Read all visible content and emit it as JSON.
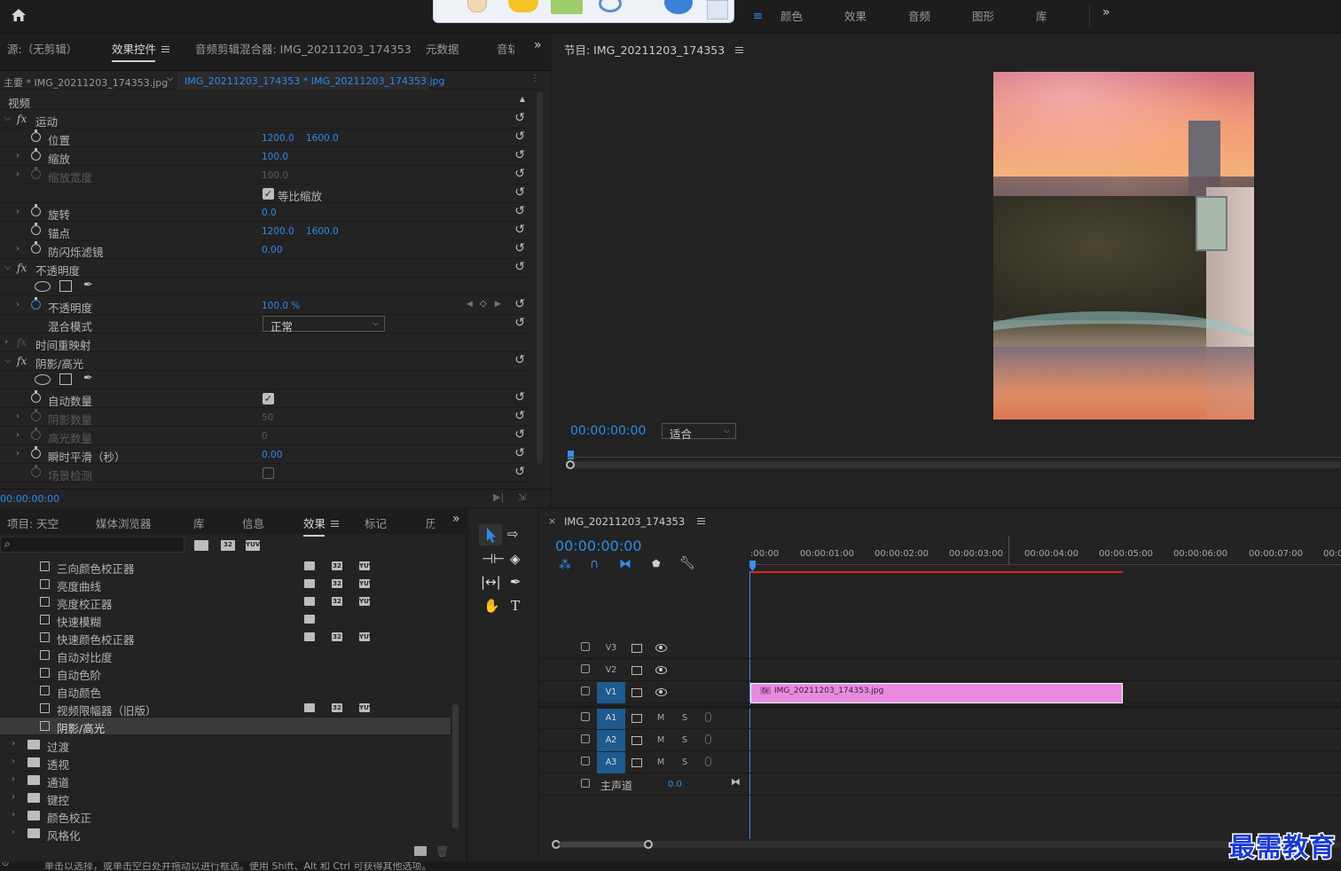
{
  "top": {
    "workspaces": [
      "颜色",
      "效果",
      "音频",
      "图形",
      "库"
    ]
  },
  "source_panel": {
    "tabs": [
      "源:（无剪辑）",
      "效果控件",
      "音频剪辑混合器: IMG_20211203_174353",
      "元数据",
      "音轨"
    ],
    "clip_master": "主要 * IMG_20211203_174353.jpg",
    "clip_active": "IMG_20211203_174353 * IMG_20211203_174353.jpg",
    "section_video": "视频",
    "timecode": "00:00:00:00",
    "rows": {
      "motion": "运动",
      "position": "位置",
      "position_x": "1200.0",
      "position_y": "1600.0",
      "scale": "缩放",
      "scale_value": "100.0",
      "scale_width": "缩放宽度",
      "scale_width_value": "100.0",
      "uniform_scale": "等比缩放",
      "rotation": "旋转",
      "rotation_value": "0.0",
      "anchor": "锚点",
      "anchor_x": "1200.0",
      "anchor_y": "1600.0",
      "anti_flicker": "防闪烁滤镜",
      "anti_flicker_value": "0.00",
      "opacity_group": "不透明度",
      "opacity": "不透明度",
      "opacity_value": "100.0 %",
      "blend_mode": "混合模式",
      "blend_mode_value": "正常",
      "time_remap": "时间重映射",
      "shadow_highlight": "阴影/高光",
      "auto_amount": "自动数量",
      "shadow_amount": "阴影数量",
      "shadow_amount_value": "50",
      "highlight_amount": "高光数量",
      "highlight_amount_value": "0",
      "temporal_smooth": "瞬时平滑（秒）",
      "temporal_smooth_value": "0.00",
      "scene_detect": "场景检测"
    }
  },
  "program": {
    "title": "节目: IMG_20211203_174353",
    "timecode": "00:00:00:00",
    "fit": "适合"
  },
  "project_panel": {
    "tabs": [
      "项目: 天空",
      "媒体浏览器",
      "库",
      "信息",
      "效果",
      "标记",
      "历"
    ],
    "search_placeholder": "",
    "effects": [
      {
        "name": "三向颜色校正器",
        "badges": [
          "32",
          "32",
          "YUV"
        ]
      },
      {
        "name": "亮度曲线",
        "badges": [
          "32",
          "32",
          "YUV"
        ]
      },
      {
        "name": "亮度校正器",
        "badges": [
          "32",
          "32",
          "YUV"
        ]
      },
      {
        "name": "快速模糊",
        "badges": [
          "32"
        ]
      },
      {
        "name": "快速颜色校正器",
        "badges": [
          "32",
          "32",
          "YUV"
        ]
      },
      {
        "name": "自动对比度",
        "badges": []
      },
      {
        "name": "自动色阶",
        "badges": []
      },
      {
        "name": "自动颜色",
        "badges": []
      },
      {
        "name": "视频限幅器（旧版）",
        "badges": [
          "32",
          "32",
          "YUV"
        ]
      },
      {
        "name": "阴影/高光",
        "badges": []
      }
    ],
    "folders": [
      "过渡",
      "透视",
      "通道",
      "键控",
      "颜色校正",
      "风格化"
    ]
  },
  "timeline": {
    "sequence": "IMG_20211203_174353",
    "timecode": "00:00:00:00",
    "ruler": [
      ":00:00",
      "00:00:01:00",
      "00:00:02:00",
      "00:00:03:00",
      "00:00:04:00",
      "00:00:05:00",
      "00:00:06:00",
      "00:00:07:00",
      "00:0"
    ],
    "tracks": {
      "v3": "V3",
      "v2": "V2",
      "v1": "V1",
      "a1": "A1",
      "a2": "A2",
      "a3": "A3",
      "m": "M",
      "s": "S",
      "master": "主声道",
      "master_value": "0.0"
    },
    "clip": "IMG_20211203_174353.jpg"
  },
  "status": "单击以选择，或单击空白处并拖动以进行框选。使用 Shift、Alt 和 Ctrl 可获得其他选项。",
  "watermark": "最需教育",
  "colors": {
    "accent": "#2d8ceb",
    "clip": "#e88be0",
    "track_selected": "#1f5a8f",
    "playhead": "#3a8ef0",
    "work_area": "#e02020"
  }
}
